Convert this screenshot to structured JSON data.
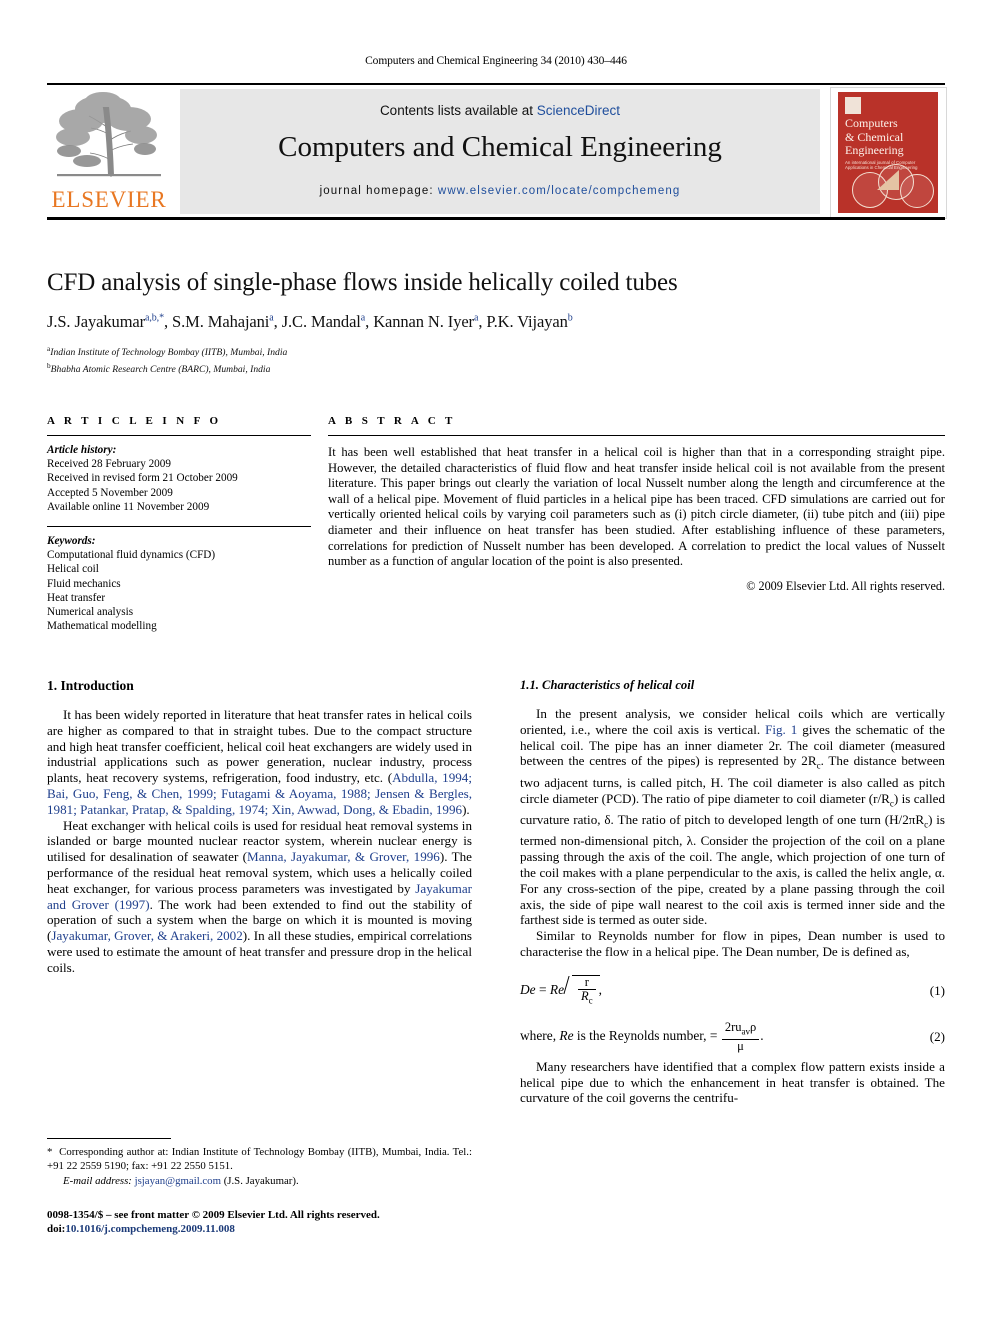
{
  "running_head": "Computers and Chemical Engineering 34 (2010) 430–446",
  "masthead": {
    "contents_prefix": "Contents lists available at ",
    "contents_link": "ScienceDirect",
    "journal_title": "Computers and Chemical Engineering",
    "homepage_prefix": "journal homepage: ",
    "homepage_url": "www.elsevier.com/locate/compchemeng",
    "publisher_logo_text": "ELSEVIER",
    "cover": {
      "title_line1": "Computers",
      "title_line2": "& Chemical",
      "title_line3": "Engineering",
      "subtitle": "An international journal of Computer Applications in Chemical Engineering",
      "background_color": "#b93229"
    }
  },
  "article": {
    "title": "CFD analysis of single-phase flows inside helically coiled tubes",
    "authors_html": "J.S. Jayakumar<sup>a,b,*</sup>, S.M. Mahajani<sup>a</sup>, J.C. Mandal<sup>a</sup>, Kannan N. Iyer<sup>a</sup>, P.K. Vijayan<sup>b</sup>",
    "affiliations": [
      {
        "marker": "a",
        "text": "Indian Institute of Technology Bombay (IITB), Mumbai, India"
      },
      {
        "marker": "b",
        "text": "Bhabha Atomic Research Centre (BARC), Mumbai, India"
      }
    ]
  },
  "article_info": {
    "heading": "A R T I C L E   I N F O",
    "history_label": "Article history:",
    "history": [
      "Received 28 February 2009",
      "Received in revised form 21 October 2009",
      "Accepted 5 November 2009",
      "Available online 11 November 2009"
    ],
    "keywords_label": "Keywords:",
    "keywords": [
      "Computational fluid dynamics (CFD)",
      "Helical coil",
      "Fluid mechanics",
      "Heat transfer",
      "Numerical analysis",
      "Mathematical modelling"
    ]
  },
  "abstract": {
    "heading": "A B S T R A C T",
    "text": "It has been well established that heat transfer in a helical coil is higher than that in a corresponding straight pipe. However, the detailed characteristics of fluid flow and heat transfer inside helical coil is not available from the present literature. This paper brings out clearly the variation of local Nusselt number along the length and circumference at the wall of a helical pipe. Movement of fluid particles in a helical pipe has been traced. CFD simulations are carried out for vertically oriented helical coils by varying coil parameters such as (i) pitch circle diameter, (ii) tube pitch and (iii) pipe diameter and their influence on heat transfer has been studied. After establishing influence of these parameters, correlations for prediction of Nusselt number has been developed. A correlation to predict the local values of Nusselt number as a function of angular location of the point is also presented.",
    "copyright": "© 2009 Elsevier Ltd. All rights reserved."
  },
  "sections": {
    "intro_heading": "1.  Introduction",
    "intro_p1_a": "It has been widely reported in literature that heat transfer rates in helical coils are higher as compared to that in straight tubes. Due to the compact structure and high heat transfer coefficient, helical coil heat exchangers are widely used in industrial applications such as power generation, nuclear industry, process plants, heat recovery systems, refrigeration, food industry, etc. (",
    "intro_p1_cite": "Abdulla, 1994; Bai, Guo, Feng, & Chen, 1999; Futagami & Aoyama, 1988; Jensen & Bergles, 1981; Patankar, Pratap, & Spalding, 1974; Xin, Awwad, Dong, & Ebadin, 1996",
    "intro_p1_b": ").",
    "intro_p2_a": "Heat exchanger with helical coils is used for residual heat removal systems in islanded or barge mounted nuclear reactor system, wherein nuclear energy is utilised for desalination of seawater (",
    "intro_p2_cite1": "Manna, Jayakumar, & Grover, 1996",
    "intro_p2_b": "). The performance of the residual heat removal system, which uses a helically coiled heat exchanger, for various process parameters was investigated by ",
    "intro_p2_cite2": "Jayakumar and Grover (1997)",
    "intro_p2_c": ". The work had been extended to find out the stability of operation of such a system when the barge on which it is mounted is moving (",
    "intro_p2_cite3": "Jayakumar, Grover, & Arakeri, 2002",
    "intro_p2_d": "). In all these studies, empirical correlations were used to estimate the amount of heat transfer and pressure drop in the helical coils.",
    "sub_heading": "1.1.  Characteristics of helical coil",
    "right_p1_a": "In the present analysis, we consider helical coils which are vertically oriented, i.e., where the coil axis is vertical. ",
    "right_p1_figref": "Fig. 1",
    "right_p1_b": " gives the schematic of the helical coil. The pipe has an inner diameter 2r. The coil diameter (measured between the centres of the pipes) is represented by 2R",
    "right_p1_sub1": "c",
    "right_p1_c": ". The distance between two adjacent turns, is called pitch, H. The coil diameter is also called as pitch circle diameter (PCD). The ratio of pipe diameter to coil diameter (r/R",
    "right_p1_sub2": "c",
    "right_p1_d": ") is called curvature ratio, δ. The ratio of pitch to developed length of one turn (H/2πR",
    "right_p1_sub3": "c",
    "right_p1_e": ") is termed non-dimensional pitch, λ. Consider the projection of the coil on a plane passing through the axis of the coil. The angle, which projection of one turn of the coil makes with a plane perpendicular to the axis, is called the helix angle, α. For any cross-section of the pipe, created by a plane passing through the coil axis, the side of pipe wall nearest to the coil axis is termed inner side and the farthest side is termed as outer side.",
    "right_p2": "Similar to Reynolds number for flow in pipes, Dean number is used to characterise the flow in a helical pipe. The Dean number, De is defined as,",
    "right_p3": "Many researchers have identified that a complex flow pattern exists inside a helical pipe due to which the enhancement in heat transfer is obtained. The curvature of the coil governs the centrifu-"
  },
  "equations": {
    "eq1": {
      "lhs": "De",
      "eq": "=",
      "rhs_factor": "Re",
      "radicand_num": "r",
      "radicand_den": "R",
      "radicand_den_sub": "c",
      "trailing": ",",
      "number": "(1)"
    },
    "eq2": {
      "prefix_a": "where, ",
      "prefix_it": "Re",
      "prefix_b": " is the Reynolds number,",
      "eq": "=",
      "num": "2ru",
      "num_sub": "av",
      "num_rho": "ρ",
      "den": "μ",
      "trailing": ".",
      "number": "(2)"
    }
  },
  "footnote": {
    "star": "*",
    "text": "Corresponding author at: Indian Institute of Technology Bombay (IITB), Mumbai, India. Tel.: +91 22 2559 5190; fax: +91 22 2550 5151.",
    "email_label": "E-mail address:",
    "email": "jsjayan@gmail.com",
    "email_owner": "(J.S. Jayakumar)."
  },
  "imprint": {
    "line1": "0098-1354/$ – see front matter © 2009 Elsevier Ltd. All rights reserved.",
    "doi_label": "doi:",
    "doi": "10.1016/j.compchemeng.2009.11.008"
  }
}
